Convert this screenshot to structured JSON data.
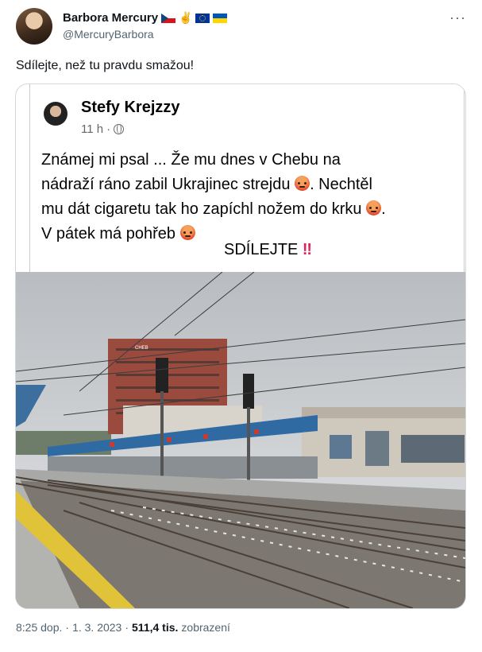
{
  "author": {
    "name": "Barbora Mercury",
    "handle": "@MercuryBarbora",
    "badges": [
      "flag-cz-icon",
      "peace-sign-icon",
      "flag-eu-icon",
      "flag-ua-icon"
    ],
    "peace_glyph": "✌"
  },
  "more_glyph": "···",
  "tweet": {
    "text": "Sdílejte, než tu pravdu smažou!"
  },
  "embedded_post": {
    "name": "Stefy Krejzzy",
    "time": "11 h",
    "dot": "·",
    "lines": [
      "Známej mi psal ...  Že mu dnes v Chebu na",
      "nádraží ráno zabil Ukrajinec strejdu",
      ". Nechtěl",
      "mu dát cigaretu tak ho zapíchl nožem do krku",
      ".",
      "V pátek má pohřeb"
    ],
    "share_text": "SDÍLEJTE",
    "share_marks": "‼",
    "photo_sign": "CHEB"
  },
  "footer": {
    "time": "8:25 dop.",
    "sep1": "·",
    "date": "1. 3. 2023",
    "sep2": "·",
    "views_count": "511,4 tis.",
    "views_label": "zobrazení"
  },
  "colors": {
    "text_primary": "#0f1419",
    "text_secondary": "#536471",
    "border": "#cfd9de",
    "emoji_red": "#e0452b"
  }
}
